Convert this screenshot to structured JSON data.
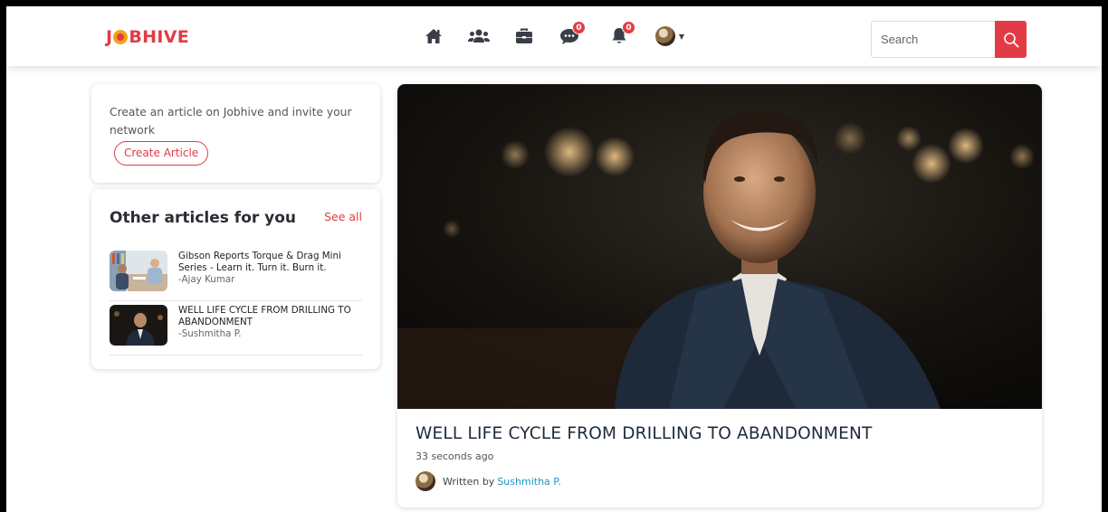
{
  "brand": {
    "logo_prefix": "J",
    "logo_suffix": "BHIVE",
    "color": "#e33b46"
  },
  "navbar": {
    "icons": [
      {
        "name": "home-icon"
      },
      {
        "name": "network-icon"
      },
      {
        "name": "jobs-icon"
      },
      {
        "name": "messages-icon",
        "badge": "0"
      },
      {
        "name": "notifications-icon",
        "badge": "0"
      },
      {
        "name": "profile-avatar"
      }
    ],
    "search": {
      "placeholder": "Search"
    }
  },
  "create_card": {
    "text": "Create an article on Jobhive and invite your network",
    "button_label": "Create Article"
  },
  "other_articles": {
    "title": "Other articles for you",
    "see_all": "See all",
    "items": [
      {
        "title": "Gibson Reports Torque & Drag Mini Series - Learn it. Turn it. Burn it.",
        "author": "-Ajay Kumar"
      },
      {
        "title": "WELL LIFE CYCLE FROM DRILLING TO ABANDONMENT",
        "author": "-Sushmitha P."
      }
    ]
  },
  "article": {
    "title": "WELL LIFE CYCLE FROM DRILLING TO ABANDONMENT",
    "time": "33 seconds ago",
    "written_by": "Written by",
    "author": "Sushmitha P."
  }
}
